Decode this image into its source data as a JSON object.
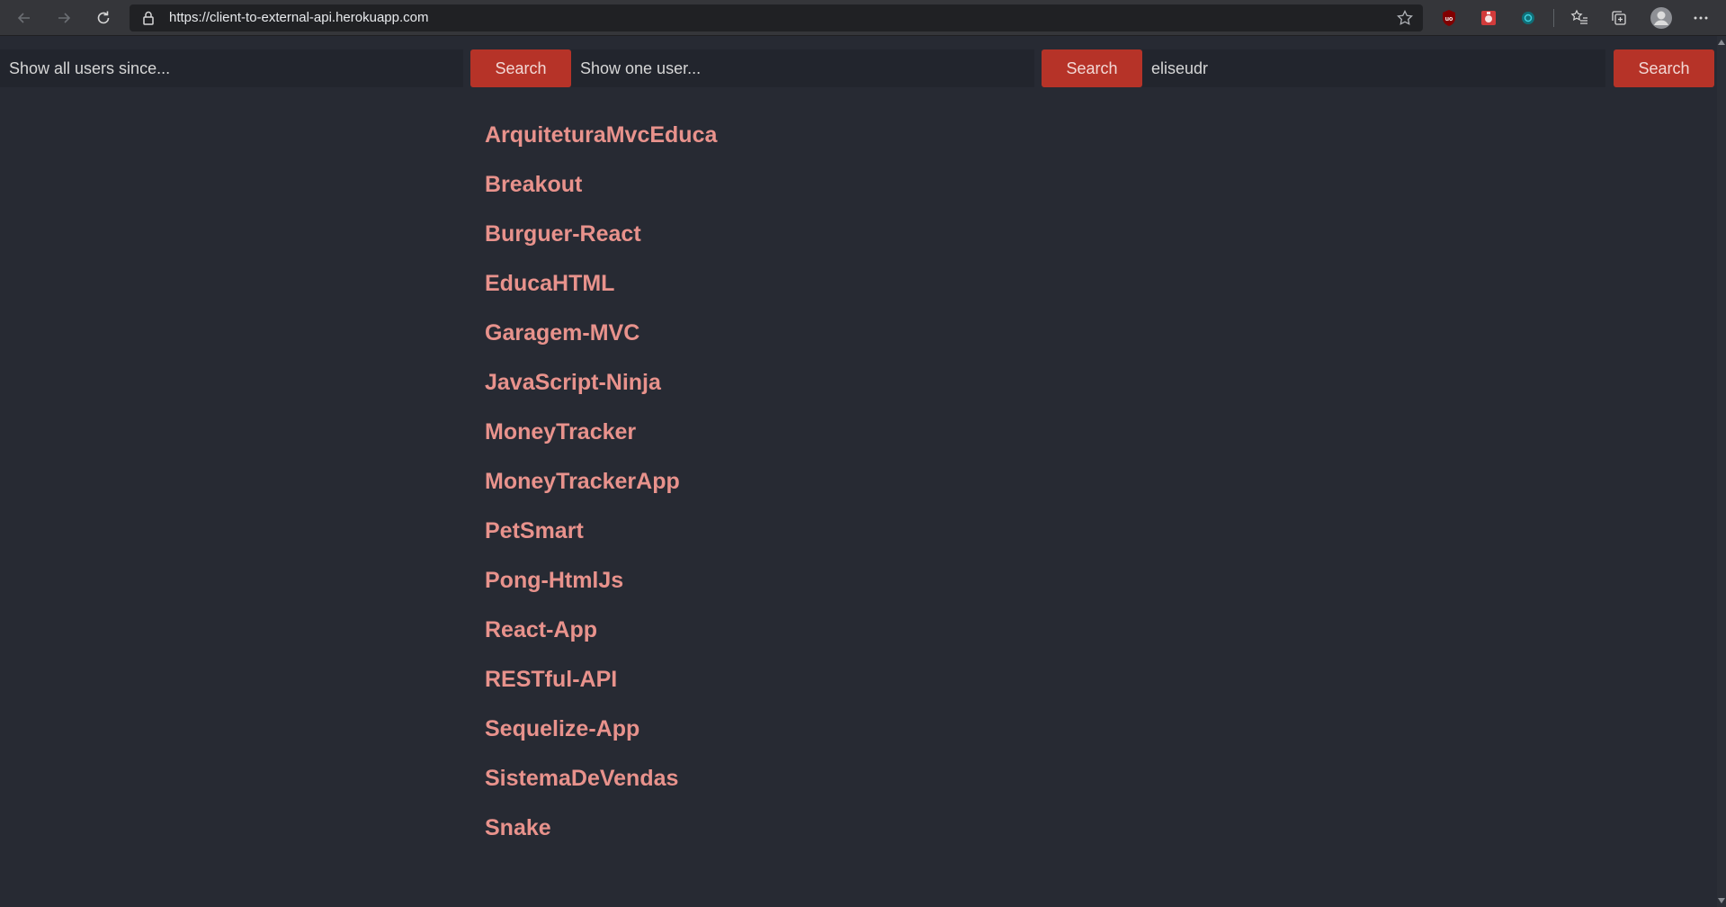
{
  "browser": {
    "url": "https://client-to-external-api.herokuapp.com",
    "icons": [
      "back-icon",
      "forward-icon",
      "refresh-icon",
      "lock-icon",
      "star-icon",
      "ublock-extension-icon",
      "red-extension-icon",
      "teal-extension-icon",
      "favorites-icon",
      "collections-icon",
      "profile-icon",
      "more-icon"
    ]
  },
  "search": {
    "since": {
      "placeholder": "Show all users since...",
      "value": "",
      "button_label": "Search"
    },
    "user": {
      "placeholder": "Show one user...",
      "value": "",
      "button_label": "Search"
    },
    "repos": {
      "placeholder": "",
      "value": "eliseudr",
      "button_label": "Search"
    }
  },
  "repos": [
    "ArquiteturaMvcEduca",
    "Breakout",
    "Burguer-React",
    "EducaHTML",
    "Garagem-MVC",
    "JavaScript-Ninja",
    "MoneyTracker",
    "MoneyTrackerApp",
    "PetSmart",
    "Pong-HtmlJs",
    "React-App",
    "RESTful-API",
    "Sequelize-App",
    "SistemaDeVendas",
    "Snake"
  ],
  "colors": {
    "page_background": "#272a33",
    "input_background": "#22252d",
    "button_background": "#b63328",
    "link_color": "#e8928c"
  }
}
